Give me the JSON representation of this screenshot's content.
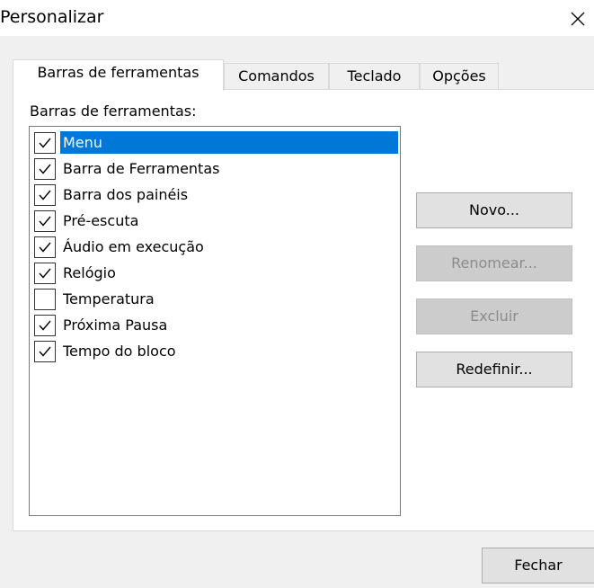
{
  "window": {
    "title": "Personalizar",
    "close_icon": "close-icon"
  },
  "tabs": [
    {
      "label": "Barras de ferramentas",
      "active": true
    },
    {
      "label": "Comandos",
      "active": false
    },
    {
      "label": "Teclado",
      "active": false
    },
    {
      "label": "Opções",
      "active": false
    }
  ],
  "toolbars_panel": {
    "label": "Barras de ferramentas:",
    "items": [
      {
        "label": "Menu",
        "checked": true,
        "selected": true
      },
      {
        "label": "Barra de Ferramentas",
        "checked": true,
        "selected": false
      },
      {
        "label": "Barra dos painéis",
        "checked": true,
        "selected": false
      },
      {
        "label": "Pré-escuta",
        "checked": true,
        "selected": false
      },
      {
        "label": "Áudio em execução",
        "checked": true,
        "selected": false
      },
      {
        "label": "Relógio",
        "checked": true,
        "selected": false
      },
      {
        "label": "Temperatura",
        "checked": false,
        "selected": false
      },
      {
        "label": "Próxima Pausa",
        "checked": true,
        "selected": false
      },
      {
        "label": "Tempo do bloco",
        "checked": true,
        "selected": false
      }
    ]
  },
  "buttons": {
    "new": {
      "label": "Novo...",
      "enabled": true
    },
    "rename": {
      "label": "Renomear...",
      "enabled": false
    },
    "delete": {
      "label": "Excluir",
      "enabled": false
    },
    "reset": {
      "label": "Redefinir...",
      "enabled": true
    }
  },
  "footer": {
    "close_label": "Fechar"
  },
  "colors": {
    "selection": "#0078d7",
    "dialog_background": "#f0f0f0",
    "button_face": "#e1e1e1",
    "disabled_button": "#cccccc"
  }
}
